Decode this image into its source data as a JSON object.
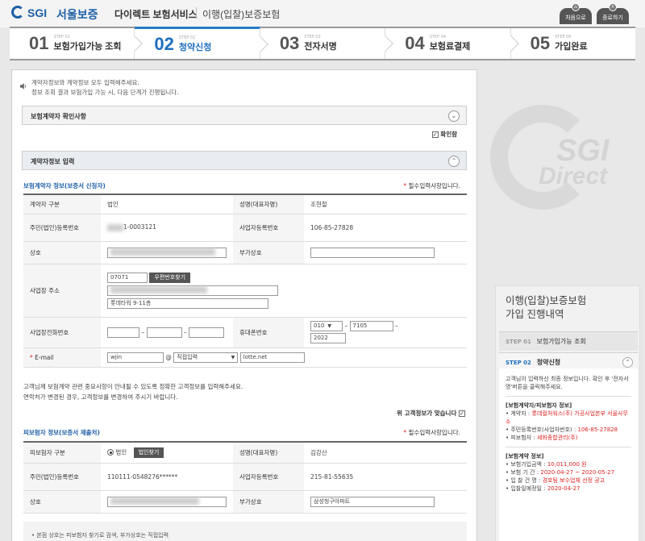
{
  "header": {
    "logo_en": "SGI",
    "logo_kr": "서울보증",
    "service_title": "다이렉트 보험서비스",
    "service_sub": "이행(입찰)보증보험",
    "btn_home": "처음으로",
    "btn_exit": "종료하기"
  },
  "steps": [
    {
      "num": "01",
      "small": "STEP 01",
      "name": "보험가입가능 조회"
    },
    {
      "num": "02",
      "small": "STEP 02",
      "name": "청약신청"
    },
    {
      "num": "03",
      "small": "STEP 03",
      "name": "전자서명"
    },
    {
      "num": "04",
      "small": "STEP 04",
      "name": "보험료결제"
    },
    {
      "num": "05",
      "small": "STEP 05",
      "name": "가입완료"
    }
  ],
  "notice": {
    "line1": "계약자정보와 계약정보 모두 입력해주세요.",
    "line2": "정보 조회 결과 보험가입 가능 시, 다음 단계가 진행됩니다."
  },
  "confirm_bar": {
    "title": "보험계약자 확인사항",
    "check_label": "확인함"
  },
  "contractor_bar": {
    "title": "계약자정보 입력"
  },
  "applicant": {
    "section_title": "보험계약자 정보(보증서 신청자)",
    "required_note": "필수입력사항입니다.",
    "type_label": "계약자 구분",
    "type_value": "법인",
    "name_label": "성명(대표자명)",
    "name_value": "조현철",
    "rrn_label": "주민(법인)등록번호",
    "rrn_value": "1-0003121",
    "biz_label": "사업자등록번호",
    "biz_value": "106-85-27828",
    "company_label": "상호",
    "subname_label": "부가상호",
    "address_label": "사업장 주소",
    "zip_value": "07071",
    "zip_btn": "우편번호찾기",
    "address_detail": "롯데타워 9-11층",
    "phone_label": "사업장전화번호",
    "mobile_label": "휴대폰번호",
    "mobile_1": "010",
    "mobile_2": "7105",
    "mobile_3": "2022",
    "email_label": "E-mail",
    "email_id": "wjin",
    "email_at": "@",
    "email_select": "직접입력",
    "email_domain": "lotte.net",
    "info_line1": "고객님께 보험계약 관련 중요사항이 안내될 수 있도록 정확한 고객정보를 입력해주세요.",
    "info_line2": "연락처가 변경된 경우, 고객정보를 변경하여 주시기 바랍니다.",
    "verify_label": "위 고객정보가 맞습니다"
  },
  "insured": {
    "section_title": "피보험자 정보(보증서 제출처)",
    "required_note": "필수입력사항입니다.",
    "type_label": "피보험자 구분",
    "type_radio": "법인",
    "type_btn": "법인찾기",
    "name_label": "성명(대표자명)",
    "name_value": "김강산",
    "rrn_label": "주민(법인)등록번호",
    "rrn_value": "110111-0548276******",
    "biz_label": "사업자등록번호",
    "biz_value": "215-81-55635",
    "company_label": "상호",
    "subname_label": "부가상호",
    "subname_value": "삼성청구아파트",
    "footnote": "본점 상호는 피보험자 찾기로 검색, 부가상호는 직접입력"
  },
  "side": {
    "logo_sgi": "SGI",
    "logo_direct": "Direct",
    "panel_title_1": "이행(입찰)보증보험",
    "panel_title_2": "가입 진행내역",
    "step1_tag": "STEP 01",
    "step1_name": "보험가입가능 조회",
    "step2_tag": "STEP 02",
    "step2_name": "청약신청",
    "desc": "고객님이 입력하신 최종 정보입니다. 확인 후 '전자서명'버튼을 클릭해주세요.",
    "grp1": "[보험계약자/피보험자 정보]",
    "contractor_label": "계약자 : ",
    "contractor_value": "롯데컬처웍스(주) 가공사업본부 서울사무소",
    "rrn_label": "주민등록번호(사업자번호) : ",
    "rrn_value": "106-85-27828",
    "insured_label": "피보험자 : ",
    "insured_value": "세화종합관리(주)",
    "grp2": "[보험계약 정보]",
    "amount_label": "보험가입금액 : ",
    "amount_value": "10,011,000 원",
    "period_label": "보험 기 간 : ",
    "period_value": "2020-04-27 ~ 2020-05-27",
    "bid_label": "입 찰 건 명 : ",
    "bid_value": "경호팀 보수업체 선정 공고",
    "bid_date_label": "입찰일예정일 : ",
    "bid_date_value": "2020-04-27"
  }
}
